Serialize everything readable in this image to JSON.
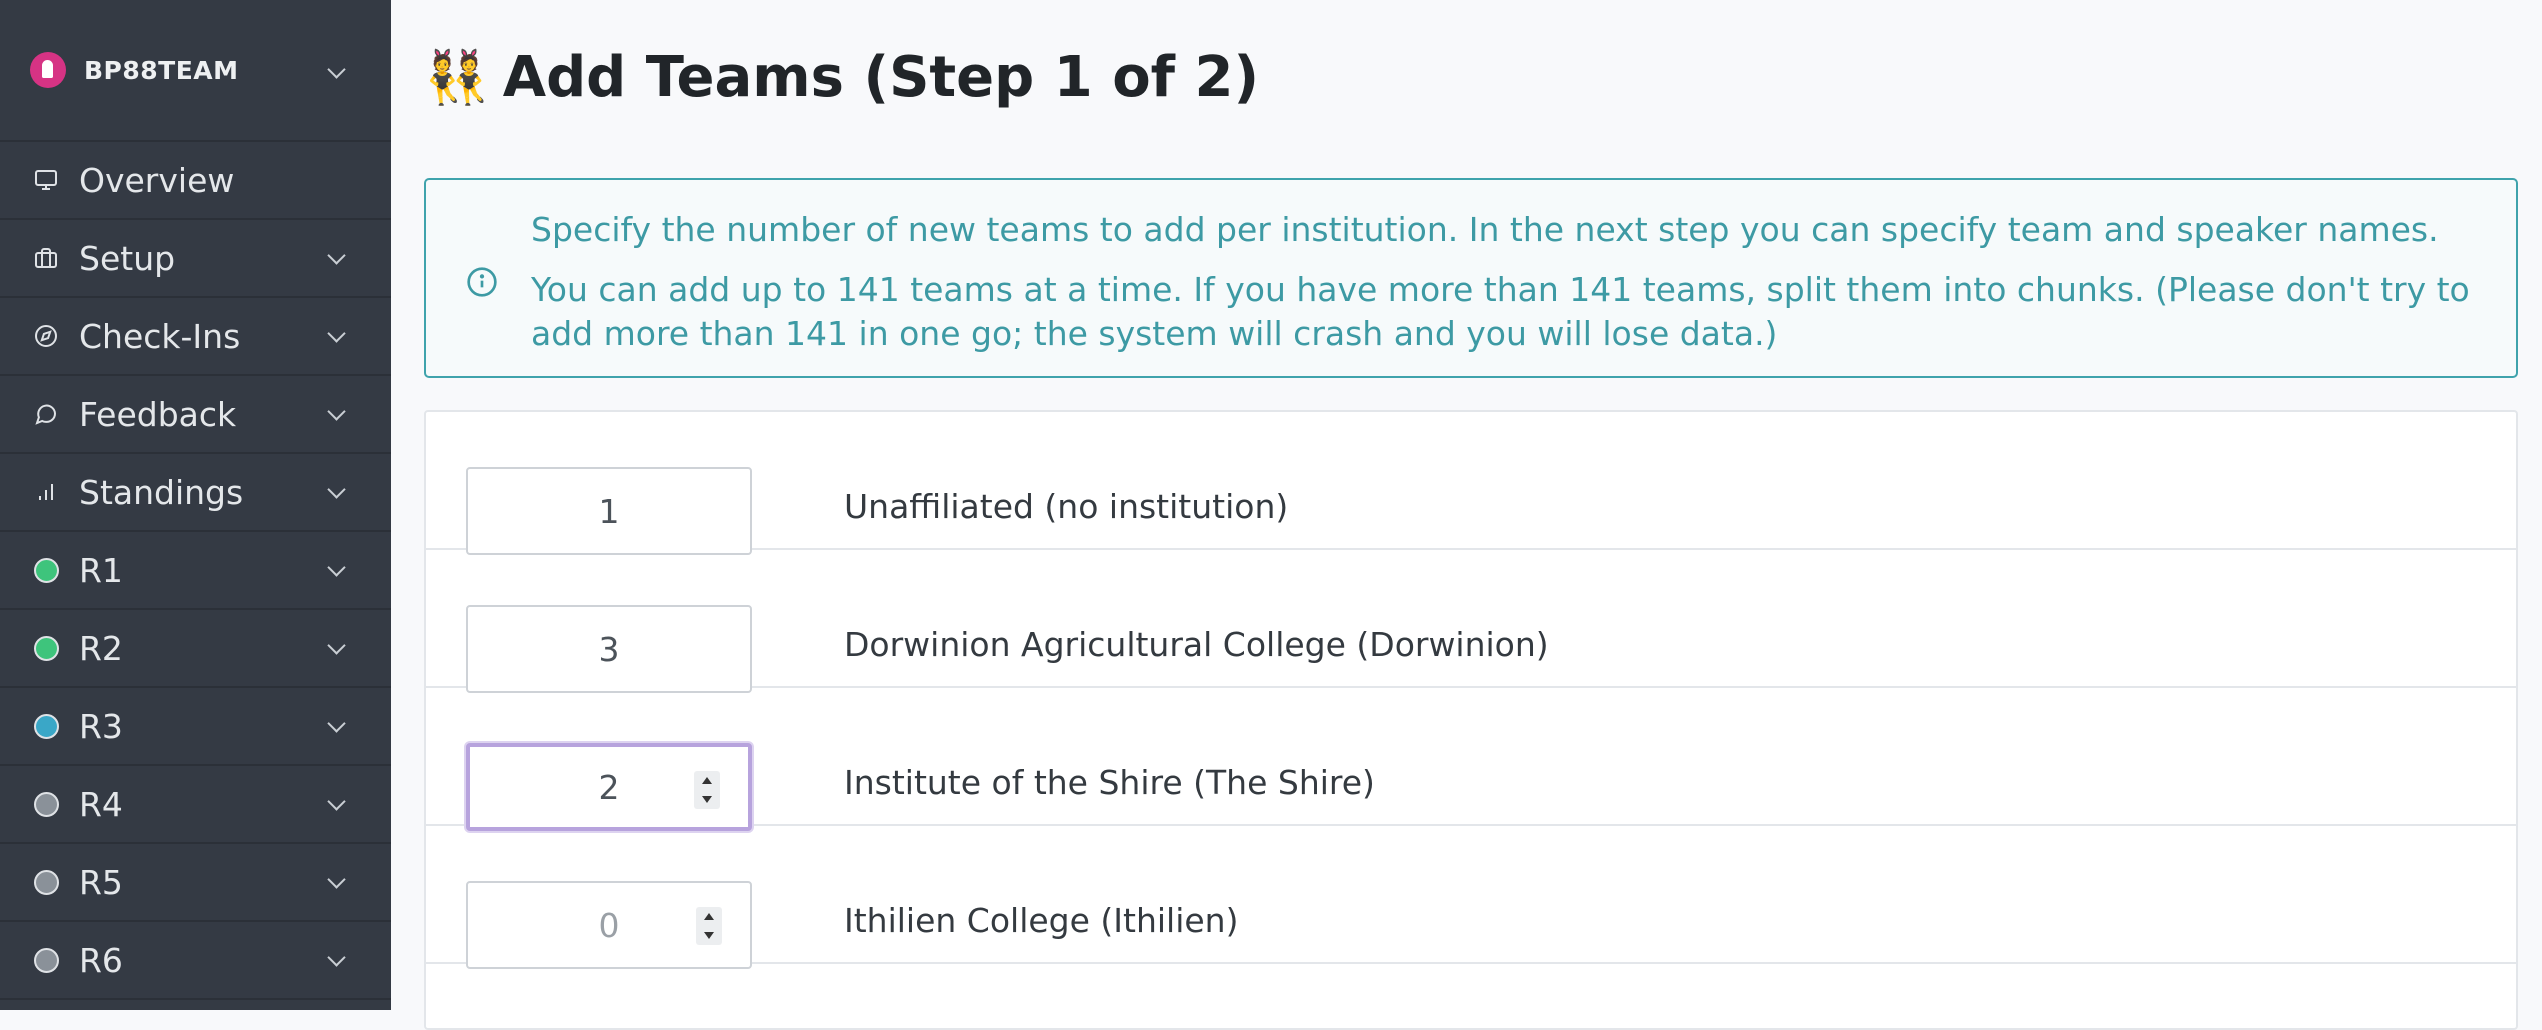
{
  "sidebar": {
    "brand": {
      "name": "BP88TEAM"
    },
    "items": [
      {
        "label": "Overview",
        "icon": "monitor-icon"
      },
      {
        "label": "Setup",
        "icon": "briefcase-icon"
      },
      {
        "label": "Check-Ins",
        "icon": "compass-icon"
      },
      {
        "label": "Feedback",
        "icon": "chat-bubble-icon"
      },
      {
        "label": "Standings",
        "icon": "bar-chart-icon"
      },
      {
        "label": "R1",
        "status_color": "#3ec47c"
      },
      {
        "label": "R2",
        "status_color": "#3ec47c"
      },
      {
        "label": "R3",
        "status_color": "#3aa7c7"
      },
      {
        "label": "R4",
        "status_color": "#8a9199"
      },
      {
        "label": "R5",
        "status_color": "#8a9199"
      },
      {
        "label": "R6",
        "status_color": "#8a9199"
      }
    ]
  },
  "page": {
    "emoji": "👯",
    "title": "Add Teams (Step 1 of 2)"
  },
  "alert": {
    "line1": "Specify the number of new teams to add per institution. In the next step you can specify team and speaker names.",
    "line2": "You can add up to 141 teams at a time. If you have more than 141 teams, split them into chunks. (Please don't try to add more than 141 in one go; the system will crash and you will lose data.)"
  },
  "institutions": [
    {
      "count": "1",
      "label": "Unaffiliated (no institution)"
    },
    {
      "count": "3",
      "label": "Dorwinion Agricultural College (Dorwinion)"
    },
    {
      "count": "2",
      "label": "Institute of the Shire (The Shire)"
    },
    {
      "placeholder": "0",
      "label": "Ithilien College (Ithilien)"
    }
  ],
  "colors": {
    "sidebar_bg": "#343a44",
    "info": "#3d9aa4",
    "focus": "#b7a3dd"
  }
}
